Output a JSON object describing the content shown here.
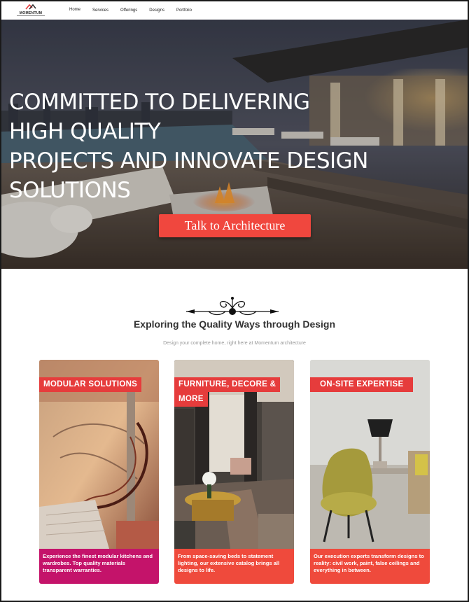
{
  "brand": {
    "name": "MOMENTUM",
    "accent": "#e63c3c"
  },
  "nav": {
    "items": [
      "Home",
      "Services",
      "Offerings",
      "Designs",
      "Portfolio"
    ]
  },
  "hero": {
    "title_lines": [
      "COMMITTED TO DELIVERING",
      "HIGH QUALITY",
      "PROJECTS AND INNOVATE DESIGN",
      "SOLUTIONS"
    ],
    "cta_label": "Talk to Architecture"
  },
  "section": {
    "title": "Exploring the Quality Ways through Design",
    "subtitle": "Design your complete home, right here at Momentum architecture"
  },
  "cards": [
    {
      "label_lines": [
        "MODULAR SOLUTIONS"
      ],
      "description": "Experience the finest modular kitchens and wardrobes. Top quality materials transparent warranties.",
      "desc_color": "#c4136a"
    },
    {
      "label_lines": [
        "FURNITURE, DECORE &",
        "MORE"
      ],
      "description": "From space-saving beds to statement lighting, our extensive catalog brings all designs to life.",
      "desc_color": "#ef4a3c"
    },
    {
      "label_lines": [
        "ON-SITE EXPERTISE"
      ],
      "description": "Our execution experts transform designs to reality: civil work, paint, false ceilings and everything in between.",
      "desc_color": "#ef4a3c"
    }
  ]
}
